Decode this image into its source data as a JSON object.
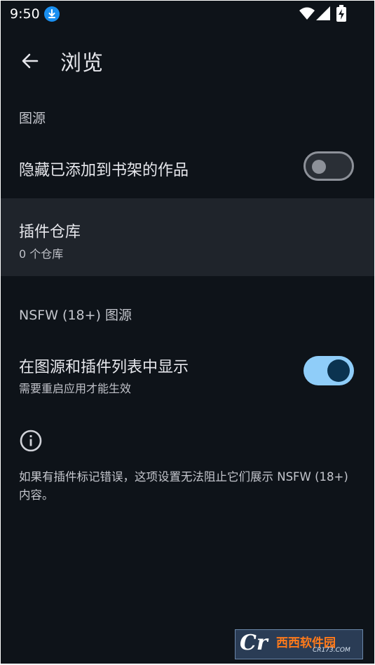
{
  "status_bar": {
    "time": "9:50",
    "icons": [
      "download-icon",
      "wifi-icon",
      "signal-icon",
      "battery-charging-icon"
    ]
  },
  "app_bar": {
    "title": "浏览",
    "back_icon": "arrow-left-icon"
  },
  "sections": {
    "sources": {
      "header": "图源",
      "hide_in_library": {
        "title": "隐藏已添加到书架的作品",
        "enabled": false
      },
      "extension_repos": {
        "title": "插件仓库",
        "summary": "0 个仓库"
      }
    },
    "nsfw": {
      "header": "NSFW (18+) 图源",
      "show_in_lists": {
        "title": "在图源和插件列表中显示",
        "summary": "需要重启应用才能生效",
        "enabled": true
      },
      "info_icon": "info-icon",
      "info_text": "如果有插件标记错误，这项设置无法阻止它们展示 NSFW (18+) 内容。"
    }
  },
  "watermark": {
    "logo": "Cr",
    "site_name": "西西软件园",
    "url": "CR173.COM"
  },
  "colors": {
    "background": "#0e1319",
    "switch_on_track": "#8fcdf9",
    "switch_on_thumb": "#0b3350",
    "switch_off_outline": "#8d9199"
  }
}
